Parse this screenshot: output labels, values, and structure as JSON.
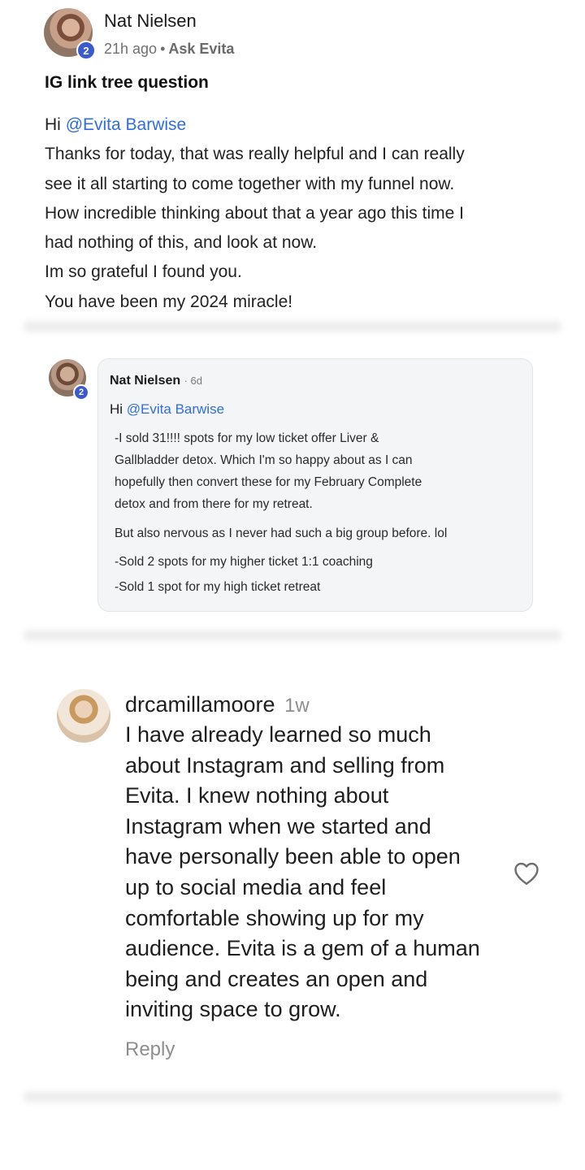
{
  "post": {
    "author": "Nat Nielsen",
    "badge": "2",
    "time": "21h ago",
    "separator": "•",
    "category": "Ask Evita",
    "title": "IG link tree question",
    "greeting": "Hi",
    "mention": "@Evita Barwise",
    "body_lines": [
      "Thanks for today, that was really helpful and I can really",
      "see it all starting to come together with my funnel now.",
      "How incredible thinking about that a year ago this time I",
      "had nothing of this, and look at now.",
      "Im so grateful I found you.",
      "You have been my 2024 miracle!"
    ]
  },
  "embedded_comment": {
    "author": "Nat Nielsen",
    "age": "· 6d",
    "badge": "2",
    "greeting": "Hi",
    "mention": "@Evita Barwise",
    "para1_lines": [
      "-I sold 31!!!! spots for my low ticket offer Liver &",
      "Gallbladder detox. Which I'm so happy about as I can",
      "hopefully then convert these for my February Complete",
      "detox and from there for my retreat."
    ],
    "para2": "But also nervous as I never had such a big group before. lol",
    "para3_lines": [
      "-Sold 2 spots for my higher ticket 1:1 coaching",
      "-Sold 1 spot for my high ticket retreat"
    ]
  },
  "ig_comment": {
    "username": "drcamillamoore",
    "age": "1w",
    "lines": [
      "I have already learned so much",
      "about Instagram and selling from",
      "Evita. I knew nothing about",
      "Instagram when we started and",
      "have personally been able to open",
      "up to social media and feel",
      "comfortable showing up for my",
      "audience. Evita is a gem of a human",
      "being and creates an open and",
      "inviting space to grow."
    ],
    "reply_label": "Reply",
    "like_icon": "heart-outline-icon"
  }
}
